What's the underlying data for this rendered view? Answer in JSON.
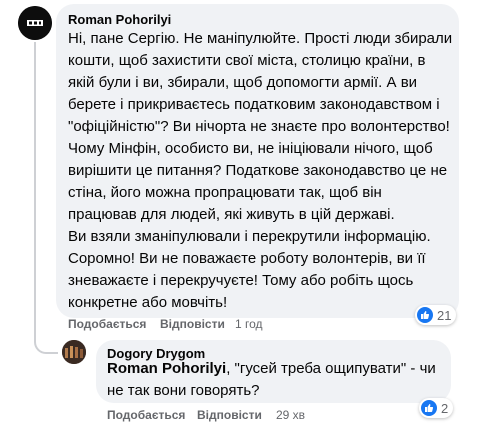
{
  "comment": {
    "author": "Roman Pohorilyi",
    "paragraphs": [
      "Ні, пане Сергію. Не маніпулюйте. Прості люди збирали кошти, щоб захистити свої міста, столицю країни, в якій були і ви, збирали, щоб допомогти армії. А ви берете і прикриваєтесь податковим законодавством і \"офіційністю\"? Ви нічорта не знаєте про волонтерство!",
      "Чому Мінфін, особисто ви, не ініціювали нічого, щоб вирішити це питання? Податкове законодавство це не стіна, його можна пропрацювати так, щоб він працював для людей, які живуть в цій державі.",
      "Ви взяли зманіпулювали і перекрутили інформацію. Соромно! Ви не поважаєте роботу волонтерів, ви її зневажаєте і перекручуєте! Тому або робіть щось конкретне або мовчіть!"
    ],
    "actions": {
      "like": "Подобається",
      "reply": "Відповісти",
      "time": "1 год"
    },
    "reactions": {
      "count": "21",
      "icon": "thumbs-up"
    }
  },
  "reply": {
    "author": "Dogory Drygom",
    "mention": "Roman Pohorilyi",
    "text": ", \"гусей треба ощипувати\" - чи не так вони говорять?",
    "actions": {
      "like": "Подобається",
      "reply": "Відповісти",
      "time": "29 хв"
    },
    "reactions": {
      "count": "2",
      "icon": "thumbs-up"
    }
  },
  "colors": {
    "bubble": "#f0f2f5",
    "meta": "#65676b",
    "like": "#1877f2"
  }
}
